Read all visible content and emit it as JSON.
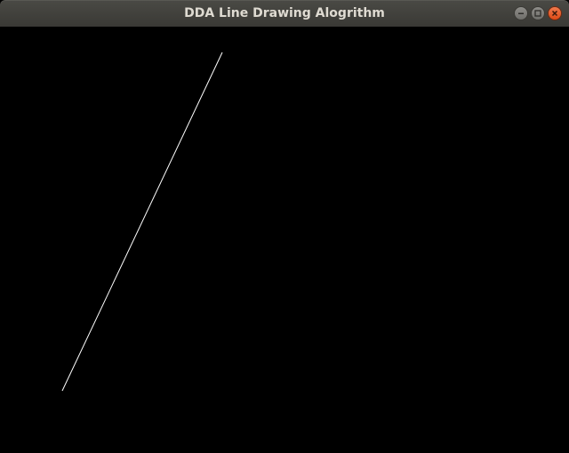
{
  "window": {
    "title": "DDA Line Drawing Alogrithm",
    "controls": [
      "minimize-icon",
      "maximize-icon",
      "close-icon"
    ]
  },
  "canvas": {
    "background": "#000000",
    "line_color": "#ffffff"
  },
  "colors": {
    "titlebar": "#3c3b37",
    "title_text": "#dfdbd2",
    "close_button": "#e95420"
  }
}
